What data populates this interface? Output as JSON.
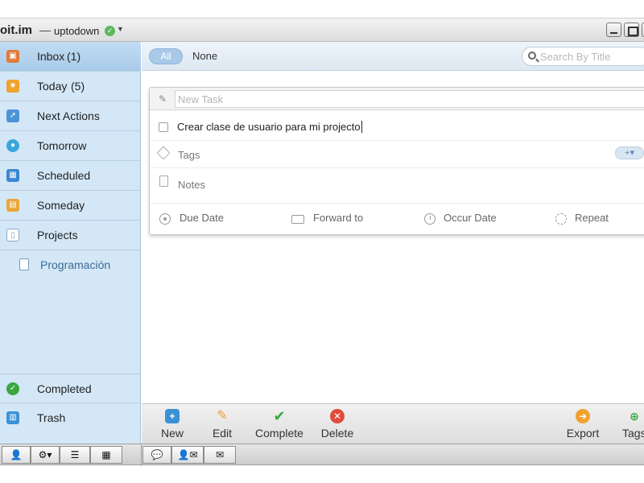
{
  "window": {
    "app_title": "oit.im",
    "separator": "—",
    "username": "uptodown"
  },
  "sidebar": {
    "items": [
      {
        "label": "Inbox",
        "count": "(1)",
        "icon": "inbox-icon",
        "color": "#e07b39",
        "active": true
      },
      {
        "label": "Today",
        "count": "(5)",
        "icon": "today-star-icon",
        "color": "#f0a22e"
      },
      {
        "label": "Next Actions",
        "count": "",
        "icon": "next-actions-icon",
        "color": "#4b93d6"
      },
      {
        "label": "Tomorrow",
        "count": "",
        "icon": "tomorrow-icon",
        "color": "#3aa5dd"
      },
      {
        "label": "Scheduled",
        "count": "",
        "icon": "calendar-icon",
        "color": "#3a87d2"
      },
      {
        "label": "Someday",
        "count": "",
        "icon": "someday-icon",
        "color": "#e8a73a"
      },
      {
        "label": "Projects",
        "count": "",
        "icon": "projects-icon",
        "color": "#8aa7c2"
      }
    ],
    "project": {
      "label": "Programación"
    },
    "completed": {
      "label": "Completed"
    },
    "trash": {
      "label": "Trash"
    }
  },
  "filter": {
    "all_label": "All",
    "none_label": "None",
    "search_placeholder": "Search By Title"
  },
  "editor": {
    "new_task_placeholder": "New Task",
    "task_title": "Crear clase de usuario para mi projecto",
    "tags_label": "Tags",
    "add_tag_label": "+▾",
    "notes_label": "Notes",
    "due_date_label": "Due Date",
    "forward_label": "Forward to",
    "occur_label": "Occur Date",
    "repeat_label": "Repeat"
  },
  "actions": {
    "new_label": "New",
    "edit_label": "Edit",
    "complete_label": "Complete",
    "delete_label": "Delete",
    "export_label": "Export",
    "tags_label": "Tags"
  },
  "colors": {
    "accent": "#a9c9e8",
    "complete_green": "#3aa640",
    "delete_red": "#e04a3a",
    "export_orange": "#f0a22e"
  }
}
